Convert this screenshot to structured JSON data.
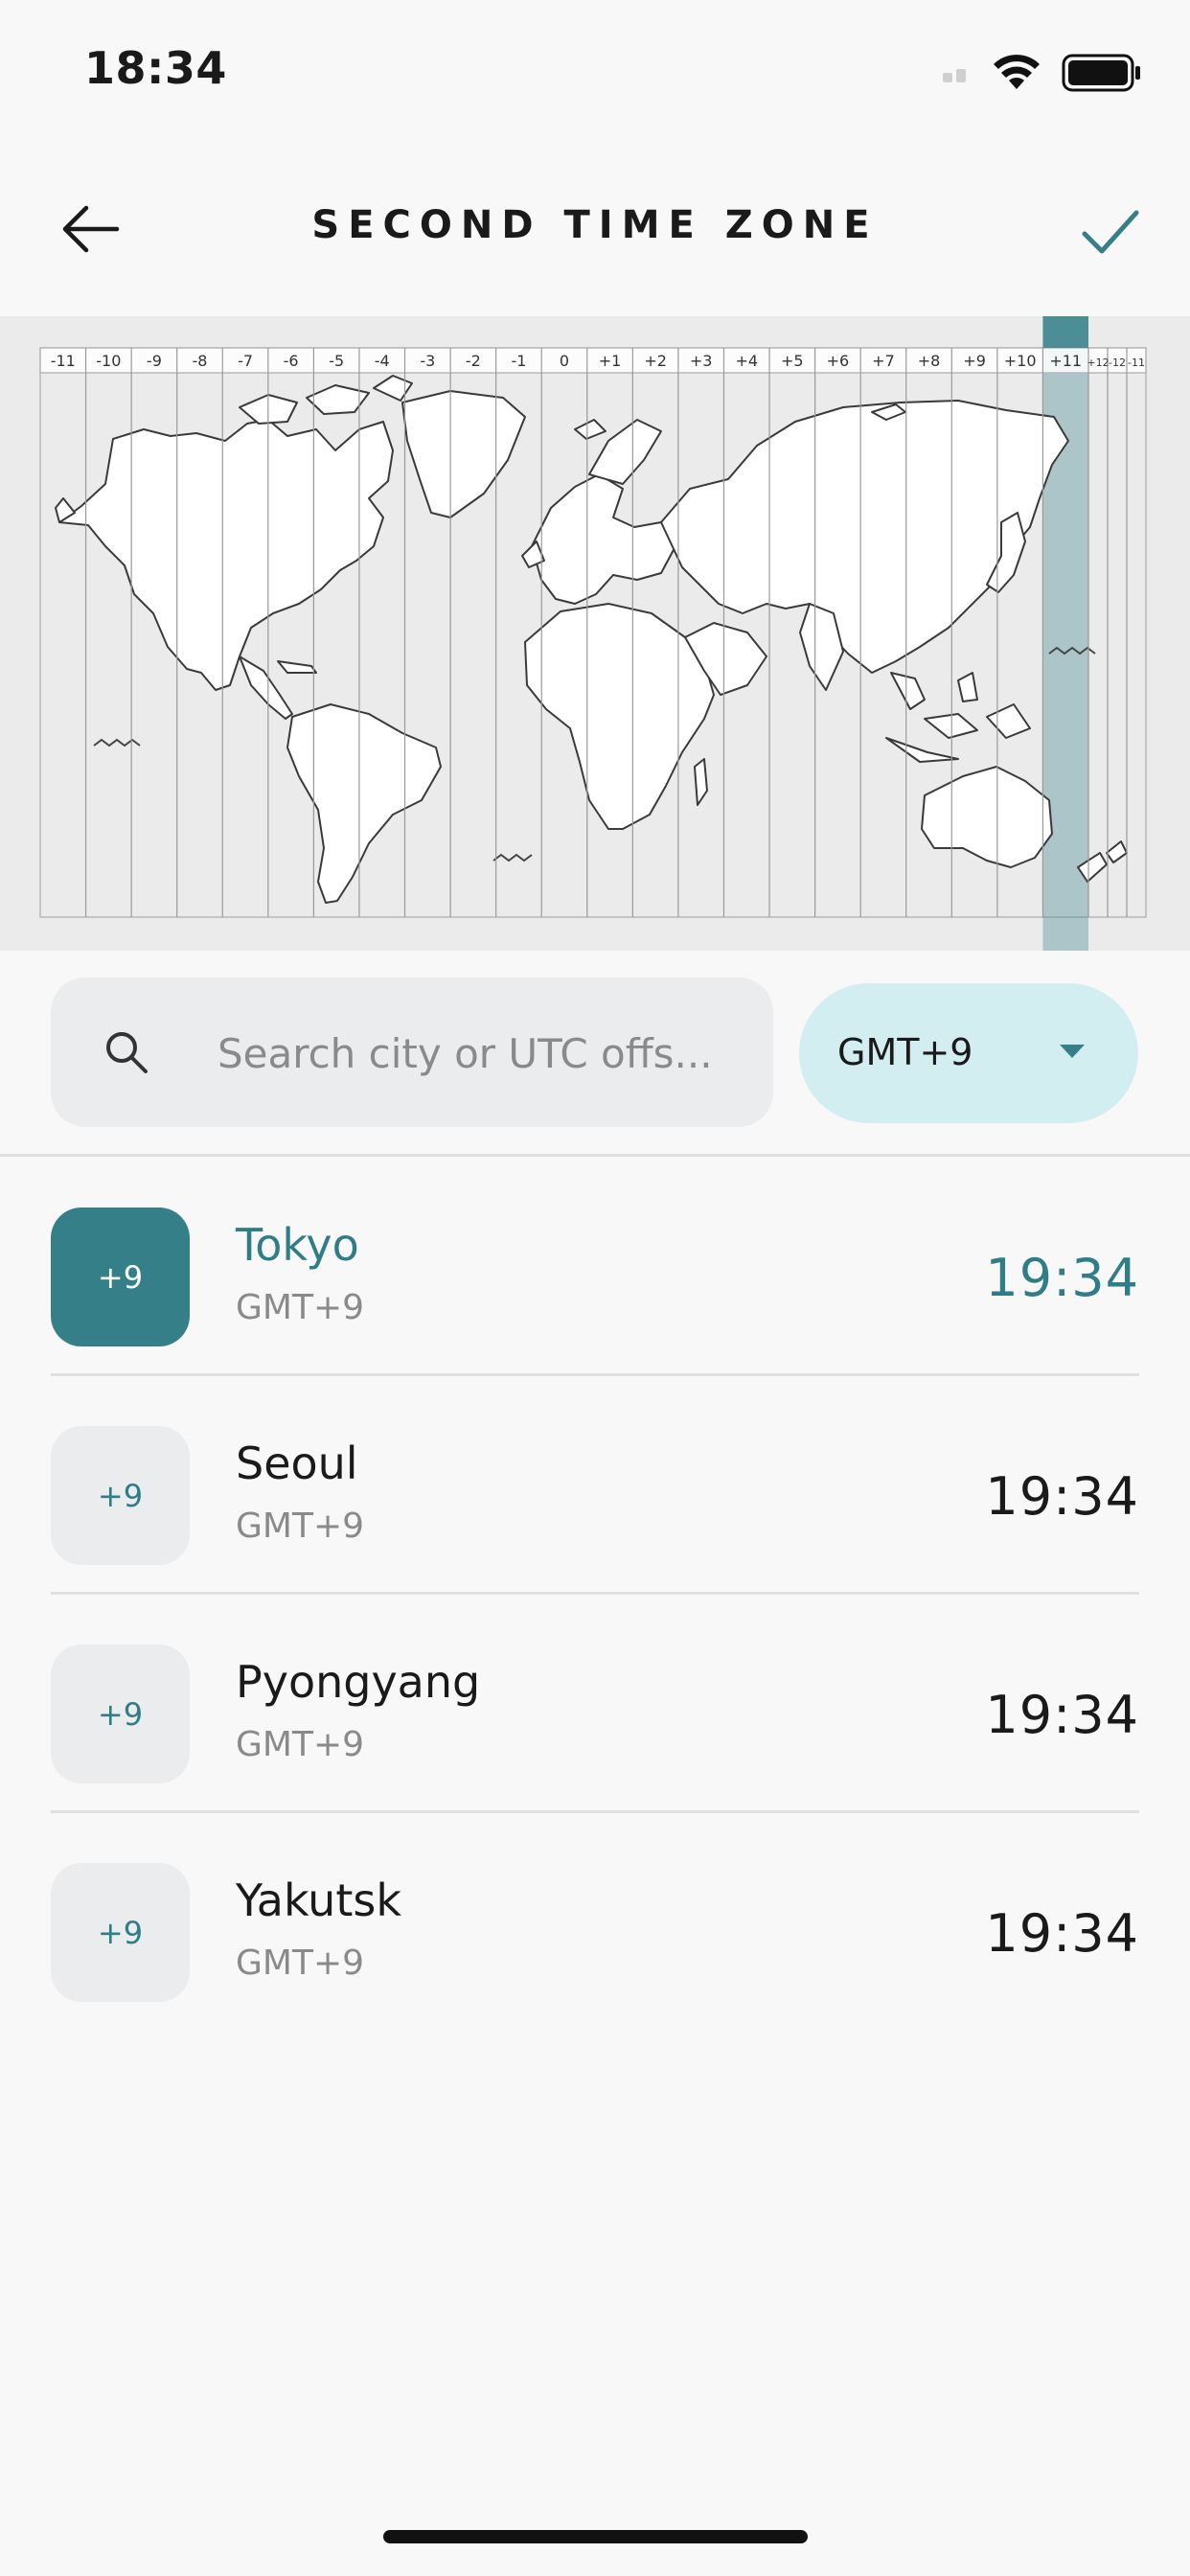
{
  "status_bar": {
    "time": "18:34"
  },
  "header": {
    "title": "SECOND TIME ZONE"
  },
  "map": {
    "zone_labels": [
      "-11",
      "-10",
      "-9",
      "-8",
      "-7",
      "-6",
      "-5",
      "-4",
      "-3",
      "-2",
      "-1",
      "0",
      "+1",
      "+2",
      "+3",
      "+4",
      "+5",
      "+6",
      "+7",
      "+8",
      "+9",
      "+10",
      "+11",
      "+12",
      "-12",
      "-11"
    ],
    "selected_zone": "+11",
    "highlight_color": "#357f88"
  },
  "search": {
    "placeholder": "Search city or UTC offs..."
  },
  "timezone_filter": {
    "selected": "GMT+9"
  },
  "cities": [
    {
      "badge": "+9",
      "name": "Tokyo",
      "zone": "GMT+9",
      "time": "19:34",
      "selected": true
    },
    {
      "badge": "+9",
      "name": "Seoul",
      "zone": "GMT+9",
      "time": "19:34",
      "selected": false
    },
    {
      "badge": "+9",
      "name": "Pyongyang",
      "zone": "GMT+9",
      "time": "19:34",
      "selected": false
    },
    {
      "badge": "+9",
      "name": "Yakutsk",
      "zone": "GMT+9",
      "time": "19:34",
      "selected": false
    }
  ],
  "colors": {
    "accent": "#357f88",
    "accent_light": "#d3eef1",
    "text": "#1a1a1a",
    "muted": "#8a8a8a"
  }
}
